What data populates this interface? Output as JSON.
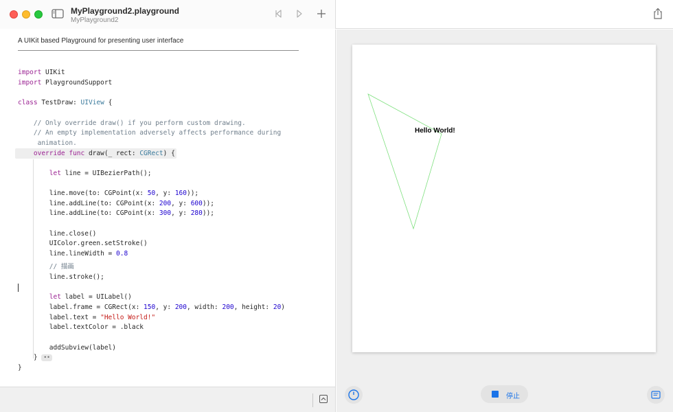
{
  "window": {
    "title": "MyPlayground2.playground",
    "subtitle": "MyPlayground2"
  },
  "editor": {
    "doc_comment": "A UIKit based Playground for presenting user interface",
    "code_lines": [
      [
        "import",
        " UIKit"
      ],
      [
        "import",
        " PlaygroundSupport"
      ],
      [
        "class",
        " TestDraw: ",
        "UIView",
        " {"
      ],
      "    // Only override draw() if you perform custom drawing.",
      "    // An empty implementation adversely affects performance during",
      "     animation.",
      [
        "    override func",
        " draw(_ rect: ",
        "CGRect",
        ") {"
      ],
      [
        "        let",
        " line = UIBezierPath();"
      ],
      [
        "        line.move(to: CGPoint(x: ",
        "50",
        ", y: ",
        "160",
        "));"
      ],
      [
        "        line.addLine(to: CGPoint(x: ",
        "200",
        ", y: ",
        "600",
        "));"
      ],
      [
        "        line.addLine(to: CGPoint(x: ",
        "300",
        ", y: ",
        "280",
        "));"
      ],
      "        line.close()",
      "        UIColor.green.setStroke()",
      [
        "        line.lineWidth = ",
        "0.8"
      ],
      "        // 描画",
      "        line.stroke();",
      [
        "        let",
        " label = UILabel()"
      ],
      [
        "        label.frame = CGRect(x: ",
        "150",
        ", y: ",
        "200",
        ", width: ",
        "200",
        ", height: ",
        "20",
        ")"
      ],
      [
        "        label.text = ",
        "\"Hello World!\""
      ],
      "        label.textColor = .black",
      "        addSubview(label)",
      "    }",
      "}"
    ]
  },
  "live_view": {
    "label_text": "Hello World!",
    "stroke_color": "#7ee07e",
    "stop_label": "停止"
  },
  "icons": {
    "sidebar": "sidebar-toggle-icon",
    "back": "chevron-left-icon",
    "forward": "chevron-right-icon",
    "add": "plus-icon",
    "share": "share-icon",
    "speed": "gauge-icon",
    "stop": "stop-icon",
    "inspector": "inspector-icon",
    "console": "console-toggle-icon"
  },
  "colors": {
    "keyword": "#9b2393",
    "type": "#3a7a9c",
    "comment": "#707f8c",
    "number": "#1c00cf",
    "string": "#c41a16",
    "accent": "#1a73e8"
  }
}
